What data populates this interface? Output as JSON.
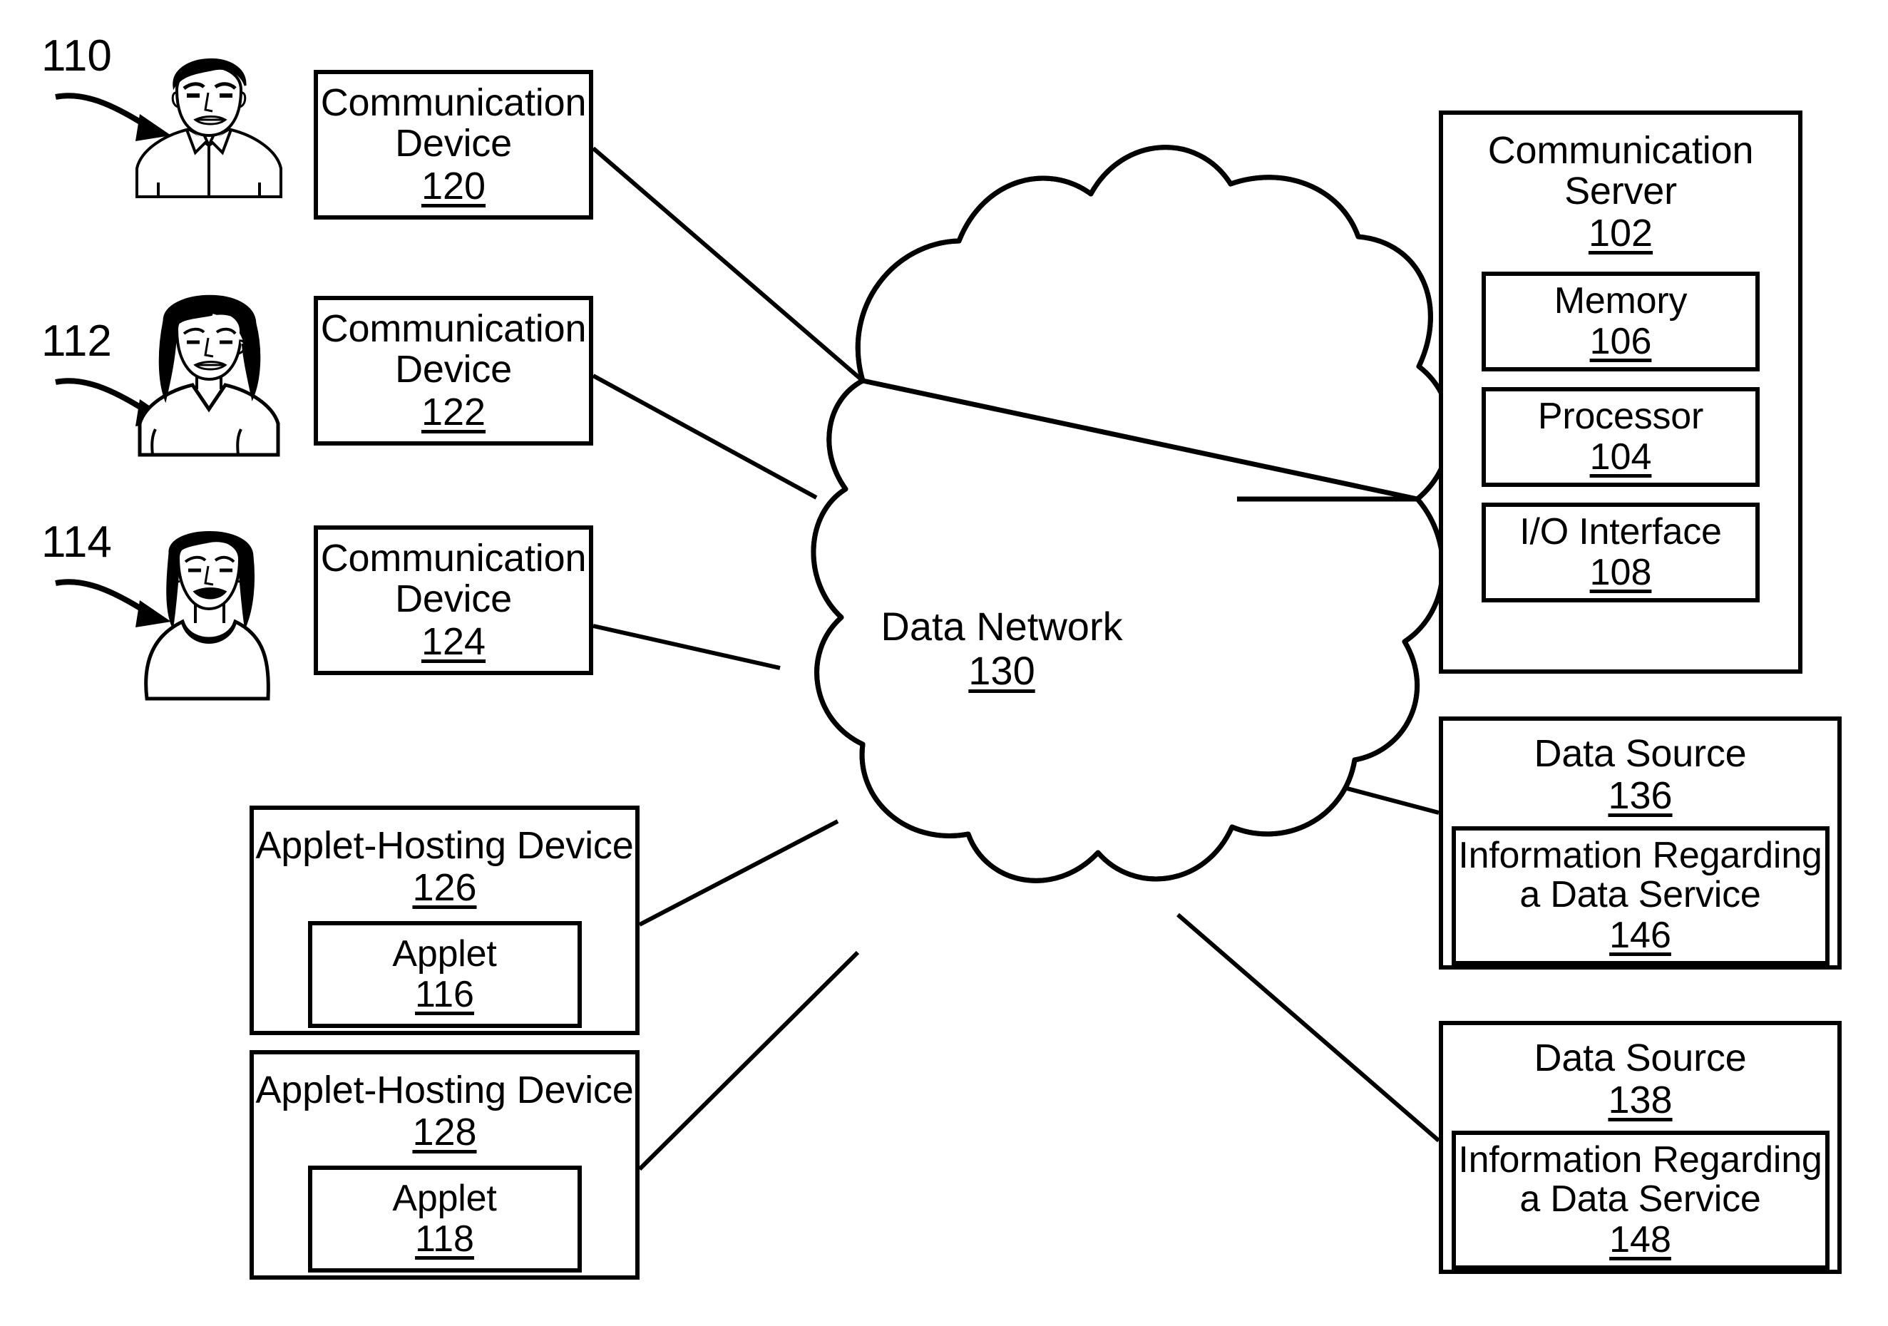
{
  "figure": {
    "title": "Network system block diagram",
    "line_color": "#000000",
    "background": "#ffffff"
  },
  "users": [
    {
      "ref": "110",
      "name": "user-male-110",
      "avatar": "male-avatar-icon"
    },
    {
      "ref": "112",
      "name": "user-female-112",
      "avatar": "female-long-hair-avatar-icon"
    },
    {
      "ref": "114",
      "name": "user-female-114",
      "avatar": "female-ponytail-avatar-icon"
    }
  ],
  "communication_devices": [
    {
      "label": "Communication\nDevice",
      "ref": "120"
    },
    {
      "label": "Communication\nDevice",
      "ref": "122"
    },
    {
      "label": "Communication\nDevice",
      "ref": "124"
    }
  ],
  "applet_hosts": [
    {
      "label": "Applet-Hosting Device",
      "ref": "126",
      "applet": {
        "label": "Applet",
        "ref": "116"
      }
    },
    {
      "label": "Applet-Hosting Device",
      "ref": "128",
      "applet": {
        "label": "Applet",
        "ref": "118"
      }
    }
  ],
  "network": {
    "label": "Data Network",
    "ref": "130",
    "shape": "cloud-icon"
  },
  "server": {
    "label": "Communication\nServer",
    "ref": "102",
    "components": [
      {
        "label": "Memory",
        "ref": "106"
      },
      {
        "label": "Processor",
        "ref": "104"
      },
      {
        "label": "I/O Interface",
        "ref": "108"
      }
    ]
  },
  "data_sources": [
    {
      "label": "Data Source",
      "ref": "136",
      "content": {
        "label": "Information Regarding\na Data Service",
        "ref": "146"
      }
    },
    {
      "label": "Data Source",
      "ref": "138",
      "content": {
        "label": "Information Regarding\na Data Service",
        "ref": "148"
      }
    }
  ]
}
